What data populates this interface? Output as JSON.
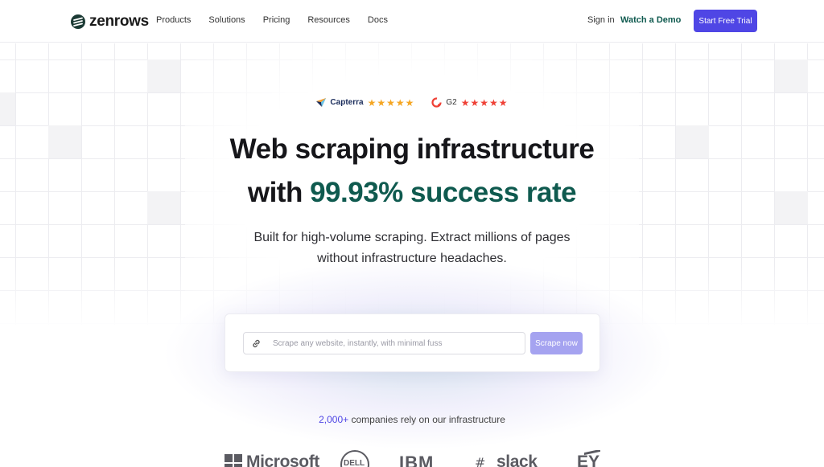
{
  "header": {
    "logo_text": "zenrows",
    "nav": [
      {
        "label": "Products"
      },
      {
        "label": "Solutions"
      },
      {
        "label": "Pricing"
      },
      {
        "label": "Resources"
      },
      {
        "label": "Docs"
      }
    ],
    "signin_label": "Sign in",
    "watch_demo_label": "Watch a Demo",
    "start_trial_label": "Start Free Trial"
  },
  "ratings": {
    "capterra": {
      "name": "Capterra",
      "stars": 5,
      "star_color": "#f5a623"
    },
    "g2": {
      "name": "G2",
      "stars": 5,
      "star_color": "#ef4136"
    }
  },
  "hero": {
    "line1": "Web scraping infrastructure",
    "line2_prefix": "with ",
    "line2_accent": "99.93% success rate",
    "sub1": "Built for high-volume scraping. Extract millions of pages",
    "sub2": "without infrastructure headaches."
  },
  "scrape": {
    "placeholder": "Scrape any website, instantly, with minimal fuss",
    "button_label": "Scrape now",
    "icon": "link-icon"
  },
  "companies": {
    "count": "2,000+",
    "text": " companies rely on our infrastructure",
    "logos": {
      "microsoft": "Microsoft",
      "dell": "DELL",
      "ibm": "IBM",
      "slack": "slack",
      "ey": "EY"
    }
  },
  "colors": {
    "brand_purple": "#4f46e5",
    "accent_green": "#0f5a4f",
    "button_disabled": "#a5a3f0"
  }
}
